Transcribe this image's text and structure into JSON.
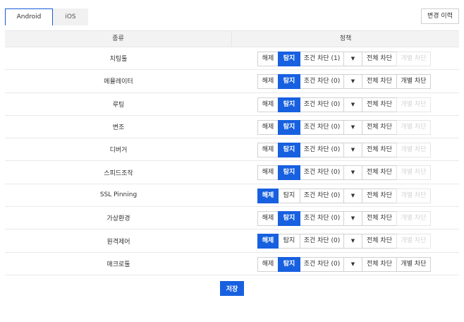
{
  "tabs": [
    {
      "label": "Android",
      "active": true
    },
    {
      "label": "iOS",
      "active": false
    }
  ],
  "history_button": "변경 이력",
  "table": {
    "headers": {
      "type": "종류",
      "policy": "정책"
    },
    "rows": [
      {
        "name": "치팅툴",
        "selected": "탐지",
        "cond": "조건 차단 (1)",
        "individual_enabled": false
      },
      {
        "name": "에뮬레이터",
        "selected": "탐지",
        "cond": "조건 차단 (0)",
        "individual_enabled": true
      },
      {
        "name": "루팅",
        "selected": "탐지",
        "cond": "조건 차단 (0)",
        "individual_enabled": false
      },
      {
        "name": "변조",
        "selected": "탐지",
        "cond": "조건 차단 (0)",
        "individual_enabled": false
      },
      {
        "name": "디버거",
        "selected": "탐지",
        "cond": "조건 차단 (0)",
        "individual_enabled": false
      },
      {
        "name": "스피드조작",
        "selected": "탐지",
        "cond": "조건 차단 (0)",
        "individual_enabled": false
      },
      {
        "name": "SSL Pinning",
        "selected": "해제",
        "cond": "조건 차단 (0)",
        "individual_enabled": false
      },
      {
        "name": "가상환경",
        "selected": "탐지",
        "cond": "조건 차단 (0)",
        "individual_enabled": false
      },
      {
        "name": "원격제어",
        "selected": "해제",
        "cond": "조건 차단 (0)",
        "individual_enabled": false
      },
      {
        "name": "매크로툴",
        "selected": "탐지",
        "cond": "조건 차단 (0)",
        "individual_enabled": true
      }
    ]
  },
  "policy_labels": {
    "release": "해제",
    "detect": "탐지",
    "dropdown_arrow": "▼",
    "block_all": "전체 차단",
    "block_individual": "개별 차단"
  },
  "save_button": "저장",
  "colors": {
    "accent": "#1760e0",
    "tab_border": "#1a5bd8"
  }
}
